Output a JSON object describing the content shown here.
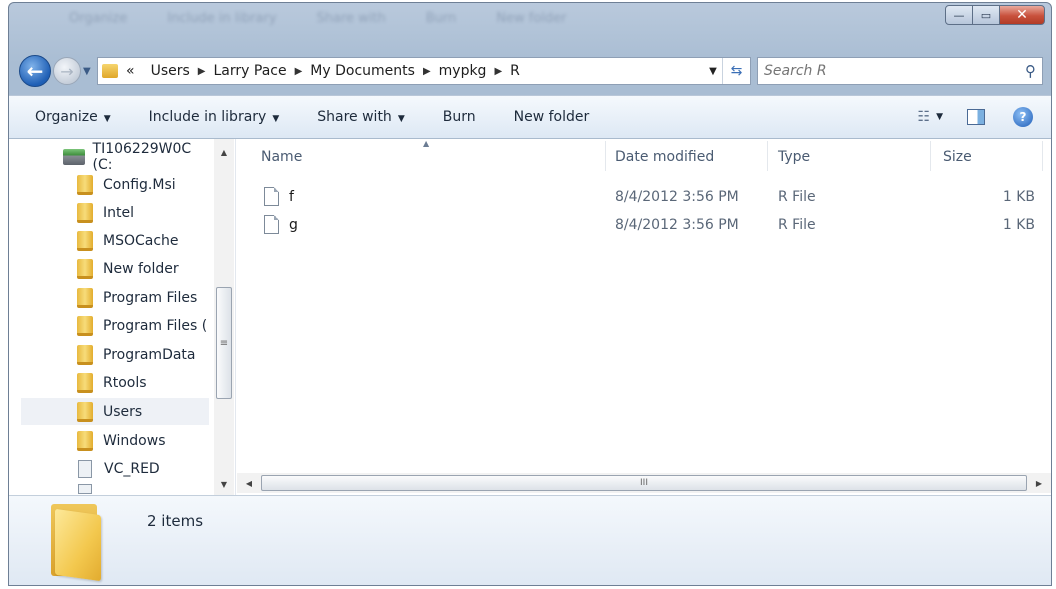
{
  "window": {
    "ghost_menu": [
      "Organize",
      "Include in library",
      "Share with",
      "Burn",
      "New folder"
    ],
    "controls": {
      "minimize": "—",
      "maximize": "▭",
      "close": "✕"
    }
  },
  "address": {
    "overflow": "«",
    "breadcrumbs": [
      "Users",
      "Larry Pace",
      "My Documents",
      "mypkg",
      "R"
    ]
  },
  "search": {
    "placeholder": "Search R"
  },
  "toolbar": {
    "organize": "Organize",
    "include_in_library": "Include in library",
    "share_with": "Share with",
    "burn": "Burn",
    "new_folder": "New folder"
  },
  "nav_pane": {
    "drive": "TI106229W0C (C:",
    "items": [
      "Config.Msi",
      "Intel",
      "MSOCache",
      "New folder",
      "Program Files",
      "Program Files (",
      "ProgramData",
      "Rtools",
      "Users",
      "Windows",
      "VC_RED"
    ],
    "selected": "Users"
  },
  "columns": {
    "name": "Name",
    "date": "Date modified",
    "type": "Type",
    "size": "Size"
  },
  "files": [
    {
      "name": "f",
      "date": "8/4/2012 3:56 PM",
      "type": "R File",
      "size": "1 KB"
    },
    {
      "name": "g",
      "date": "8/4/2012 3:56 PM",
      "type": "R File",
      "size": "1 KB"
    }
  ],
  "details": {
    "item_count": "2 items"
  },
  "colors": {
    "accent": "#1f5fb5",
    "folder": "#f3c84e",
    "selected_row": "#eef1f6"
  }
}
